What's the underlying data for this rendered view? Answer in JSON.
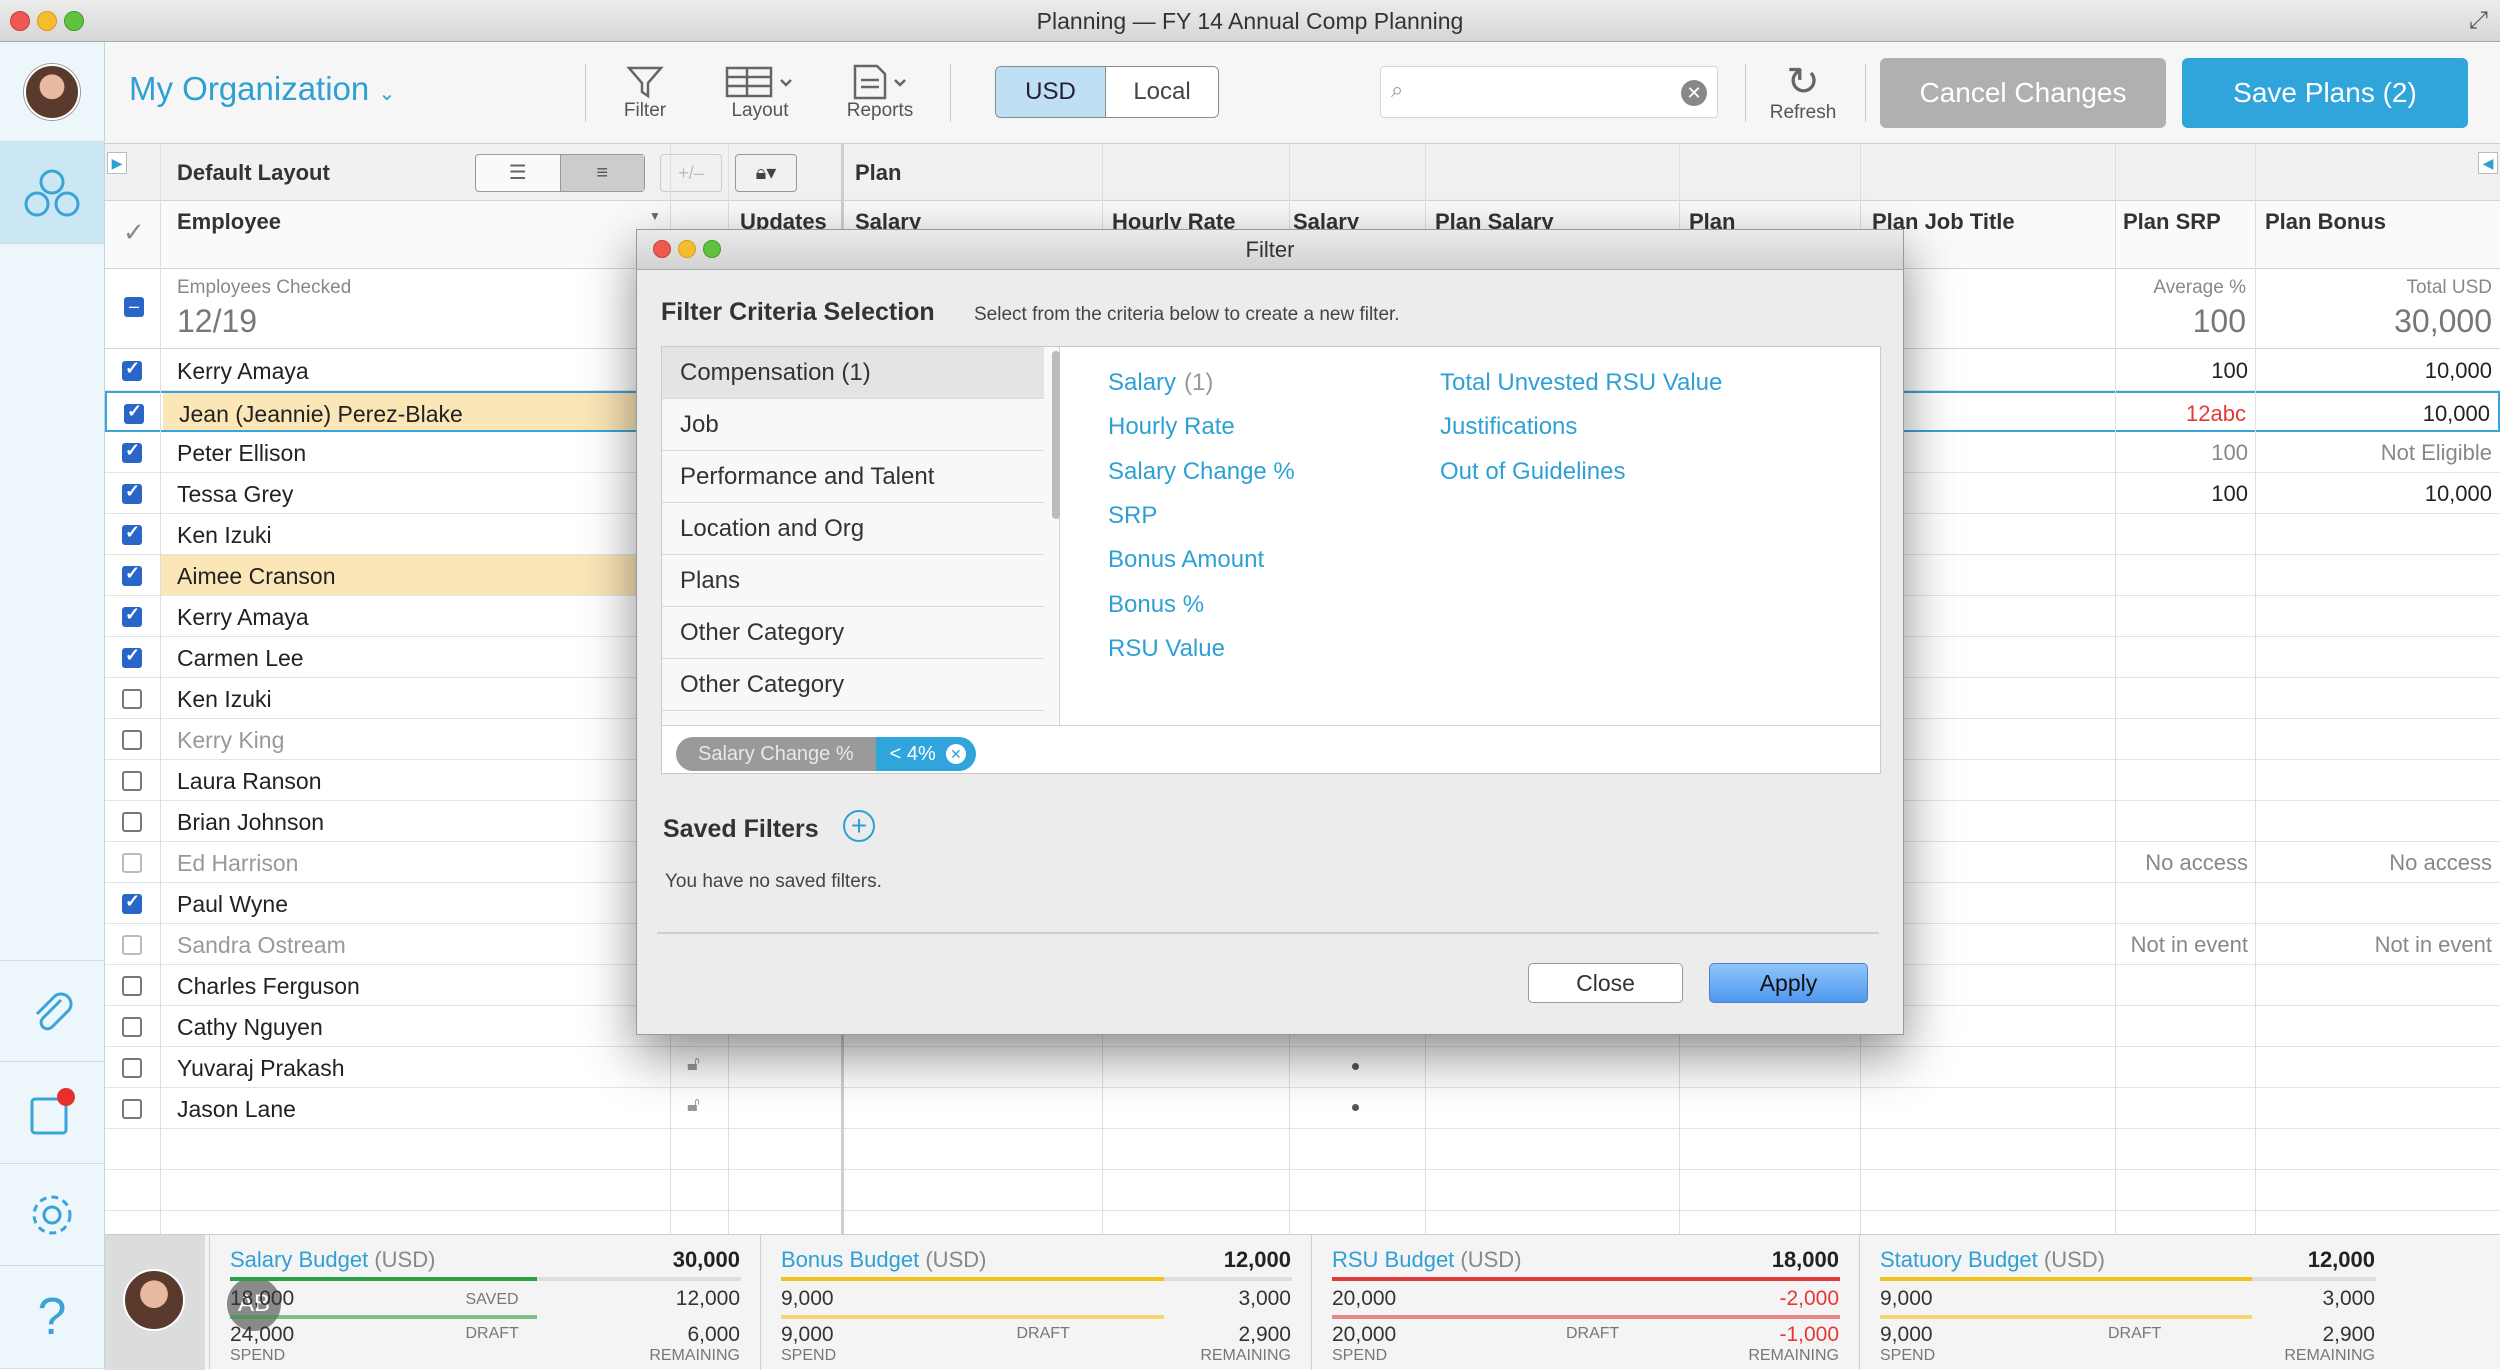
{
  "window": {
    "title": "Planning — FY 14 Annual Comp Planning"
  },
  "toolbar": {
    "org_label": "My Organization",
    "filter_label": "Filter",
    "layout_label": "Layout",
    "reports_label": "Reports",
    "currency_usd": "USD",
    "currency_local": "Local",
    "search_placeholder": "",
    "refresh_label": "Refresh",
    "cancel_label": "Cancel Changes",
    "save_label": "Save Plans (2)"
  },
  "subheader": {
    "layout_name": "Default Layout",
    "plan_label": "Plan",
    "plus_minus": "+/–"
  },
  "columns": {
    "employee": "Employee",
    "updates": "Updates",
    "salary": "Salary",
    "hourly_rate": "Hourly Rate",
    "salary2": "Salary",
    "plan_salary": "Plan Salary",
    "plan": "Plan",
    "plan_job_title": "Plan Job Title",
    "plan_srp": "Plan SRP",
    "plan_bonus": "Plan Bonus"
  },
  "summary": {
    "checked_label": "Employees Checked",
    "checked_value": "12/19",
    "srp_label": "Average %",
    "srp_value": "100",
    "bonus_label": "Total USD",
    "bonus_value": "30,000"
  },
  "employees": [
    {
      "name": "Kerry Amaya",
      "srp": "100",
      "bonus": "10,000"
    },
    {
      "name": "Jean (Jeannie) Perez-Blake",
      "srp": "12abc",
      "bonus": "10,000"
    },
    {
      "name": "Peter Ellison",
      "srp": "100",
      "bonus": "Not Eligible"
    },
    {
      "name": "Tessa Grey",
      "srp": "100",
      "bonus": "10,000"
    },
    {
      "name": "Ken Izuki",
      "srp": "",
      "bonus": ""
    },
    {
      "name": "Aimee Cranson",
      "srp": "",
      "bonus": ""
    },
    {
      "name": "Kerry Amaya",
      "srp": "",
      "bonus": ""
    },
    {
      "name": "Carmen Lee",
      "srp": "",
      "bonus": ""
    },
    {
      "name": "Ken Izuki",
      "srp": "",
      "bonus": ""
    },
    {
      "name": "Kerry King",
      "srp": "",
      "bonus": ""
    },
    {
      "name": "Laura Ranson",
      "srp": "",
      "bonus": ""
    },
    {
      "name": "Brian Johnson",
      "srp": "",
      "bonus": ""
    },
    {
      "name": "Ed Harrison",
      "title": "No access",
      "srp": "No access",
      "bonus": "No access"
    },
    {
      "name": "Paul Wyne",
      "srp": "",
      "bonus": ""
    },
    {
      "name": "Sandra Ostream",
      "title": "Not in event",
      "srp": "Not in event",
      "bonus": "Not in event"
    },
    {
      "name": "Charles Ferguson",
      "srp": "",
      "bonus": ""
    },
    {
      "name": "Cathy Nguyen",
      "srp": "",
      "bonus": ""
    },
    {
      "name": "Yuvaraj Prakash",
      "srp": "",
      "bonus": ""
    },
    {
      "name": "Jason Lane",
      "srp": "",
      "bonus": ""
    }
  ],
  "filter_modal": {
    "title": "Filter",
    "heading": "Filter Criteria Selection",
    "subheading": "Select from the criteria below to create a new filter.",
    "categories": [
      "Compensation (1)",
      "Job",
      "Performance and Talent",
      "Location and Org",
      "Plans",
      "Other Category",
      "Other Category"
    ],
    "criteria_col1": [
      "Salary",
      "Hourly Rate",
      "Salary Change %",
      "SRP",
      "Bonus Amount",
      "Bonus %",
      "RSU Value"
    ],
    "salary_count": "(1)",
    "criteria_col2": [
      "Total Unvested RSU Value",
      "Justifications",
      "Out of Guidelines"
    ],
    "chip_field": "Salary Change %",
    "chip_value": "< 4%",
    "saved_heading": "Saved Filters",
    "saved_empty": "You have no saved filters.",
    "close_label": "Close",
    "apply_label": "Apply"
  },
  "footer": {
    "user_initials": "AB",
    "budgets": [
      {
        "name": "Salary Budget",
        "unit": "(USD)",
        "total": "30,000",
        "saved": "18,000",
        "saved_label": "SAVED",
        "saved_rem": "12,000",
        "spend": "24,000",
        "draft_label": "DRAFT",
        "remaining": "6,000",
        "color": "#2aa045"
      },
      {
        "name": "Bonus Budget",
        "unit": "(USD)",
        "total": "12,000",
        "saved": "9,000",
        "saved_label": "",
        "saved_rem": "3,000",
        "spend": "9,000",
        "draft_label": "DRAFT",
        "remaining": "2,900",
        "color": "#f3c21a"
      },
      {
        "name": "RSU Budget",
        "unit": "(USD)",
        "total": "18,000",
        "saved": "20,000",
        "saved_label": "",
        "saved_rem": "-2,000",
        "spend": "20,000",
        "draft_label": "DRAFT",
        "remaining": "-1,000",
        "color": "#e03a3a"
      },
      {
        "name": "Statuory Budget",
        "unit": "(USD)",
        "total": "12,000",
        "saved": "9,000",
        "saved_label": "",
        "saved_rem": "3,000",
        "spend": "9,000",
        "draft_label": "DRAFT",
        "remaining": "2,900",
        "color": "#f3c21a"
      }
    ],
    "spend_label": "SPEND",
    "remaining_label": "REMAINING"
  }
}
